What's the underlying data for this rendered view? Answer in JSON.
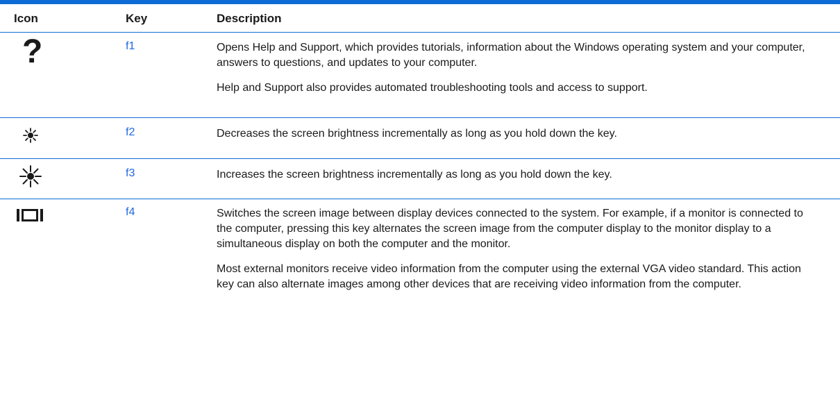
{
  "table": {
    "headers": {
      "icon": "Icon",
      "key": "Key",
      "description": "Description"
    },
    "rows": [
      {
        "icon": "help-question-mark-icon",
        "icon_glyph": "?",
        "key": "f1",
        "paragraphs": [
          "Opens Help and Support, which provides tutorials, information about the Windows operating system and your computer, answers to questions, and updates to your computer.",
          "Help and Support also provides automated troubleshooting tools and access to support."
        ]
      },
      {
        "icon": "brightness-down-icon",
        "key": "f2",
        "paragraphs": [
          "Decreases the screen brightness incrementally as long as you hold down the key."
        ]
      },
      {
        "icon": "brightness-up-icon",
        "key": "f3",
        "paragraphs": [
          "Increases the screen brightness incrementally as long as you hold down the key."
        ]
      },
      {
        "icon": "switch-display-icon",
        "key": "f4",
        "paragraphs": [
          "Switches the screen image between display devices connected to the system. For example, if a monitor is connected to the computer, pressing this key alternates the screen image from the computer display to the monitor display to a simultaneous display on both the computer and the monitor.",
          "Most external monitors receive video information from the computer using the external VGA video standard. This action key can also alternate images among other devices that are receiving video information from the computer."
        ]
      }
    ]
  },
  "colors": {
    "rule": "#0d6bd6",
    "key_link": "#1f66e0",
    "text": "#1a1a1a"
  }
}
